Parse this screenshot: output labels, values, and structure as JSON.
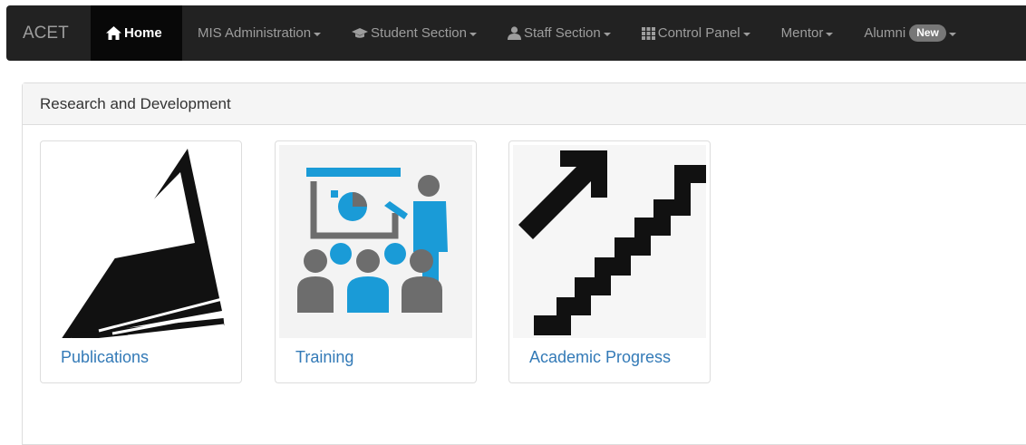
{
  "navbar": {
    "brand": "ACET",
    "items": [
      {
        "label": "Home",
        "icon": "home-icon",
        "active": true,
        "dropdown": false
      },
      {
        "label": "MIS Administration",
        "icon": "",
        "dropdown": true
      },
      {
        "label": "Student Section",
        "icon": "graduation-cap-icon",
        "dropdown": true
      },
      {
        "label": "Staff Section",
        "icon": "user-icon",
        "dropdown": true
      },
      {
        "label": "Control Panel",
        "icon": "grid-icon",
        "dropdown": true
      },
      {
        "label": "Mentor",
        "icon": "",
        "dropdown": true
      },
      {
        "label": "Alumni",
        "icon": "",
        "dropdown": true,
        "badge": "New"
      }
    ]
  },
  "panel": {
    "title": "Research and Development",
    "tiles": [
      {
        "label": "Publications",
        "icon": "publications-book-icon"
      },
      {
        "label": "Training",
        "icon": "training-presentation-icon"
      },
      {
        "label": "Academic Progress",
        "icon": "academic-progress-stairs-icon"
      }
    ]
  },
  "colors": {
    "navbar_bg": "#222222",
    "active_bg": "#080808",
    "link": "#337ab7",
    "training_blue": "#1a9bd7",
    "training_gray": "#6d6d6d"
  }
}
